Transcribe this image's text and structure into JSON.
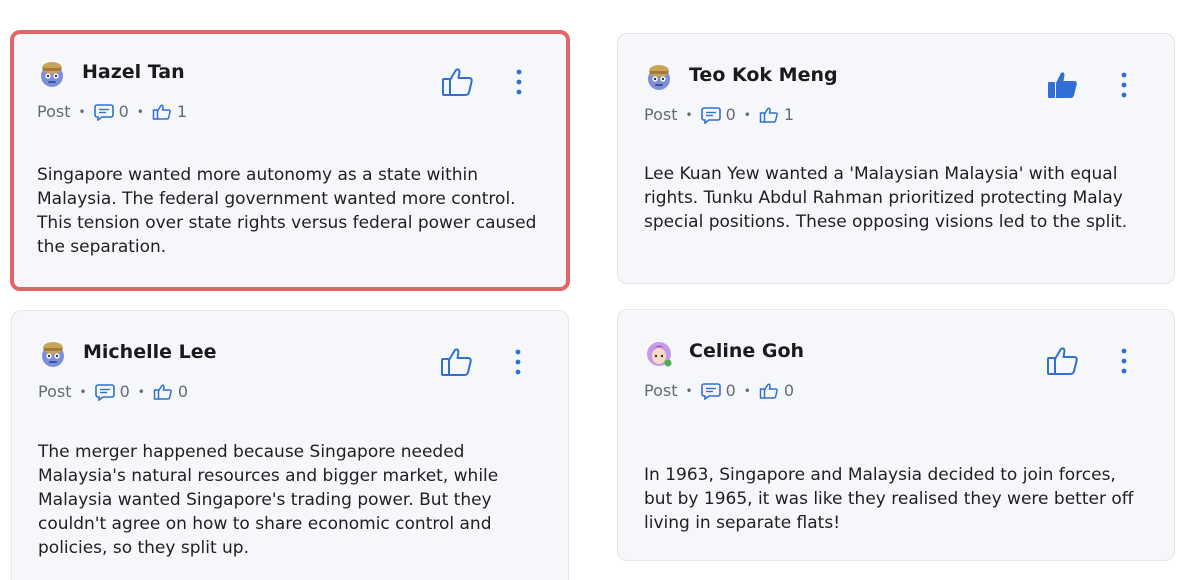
{
  "posts": [
    {
      "author": "Hazel Tan",
      "type": "Post",
      "comments": "0",
      "likes": "1",
      "liked": false,
      "avatar_icon": "robot-avatar-icon",
      "text": "Singapore wanted more autonomy as a state within Malaysia. The federal government wanted more control. This tension over state rights versus federal power caused the separation."
    },
    {
      "author": "Teo Kok Meng",
      "type": "Post",
      "comments": "0",
      "likes": "1",
      "liked": true,
      "avatar_icon": "robot-avatar-icon",
      "text": "Lee Kuan Yew wanted a 'Malaysian Malaysia' with equal rights. Tunku Abdul Rahman prioritized protecting Malay special positions. These opposing visions led to the split."
    },
    {
      "author": "Michelle Lee",
      "type": "Post",
      "comments": "0",
      "likes": "0",
      "liked": false,
      "avatar_icon": "robot-avatar-icon",
      "text": "The merger happened because Singapore needed Malaysia's natural resources and bigger market, while Malaysia wanted Singapore's trading power. But they couldn't agree on how to share economic control and policies, so they split up."
    },
    {
      "author": "Celine Goh",
      "type": "Post",
      "comments": "0",
      "likes": "0",
      "liked": false,
      "avatar_icon": "girl-avatar-icon",
      "text": "In 1963, Singapore and Malaysia decided to join forces, but by 1965, it was like they realised they were better off living in separate flats!"
    }
  ],
  "colors": {
    "accent": "#2f6fd6",
    "selected_border": "#e06666",
    "card_bg": "#f6f7fb",
    "meta_text": "#666a73"
  }
}
